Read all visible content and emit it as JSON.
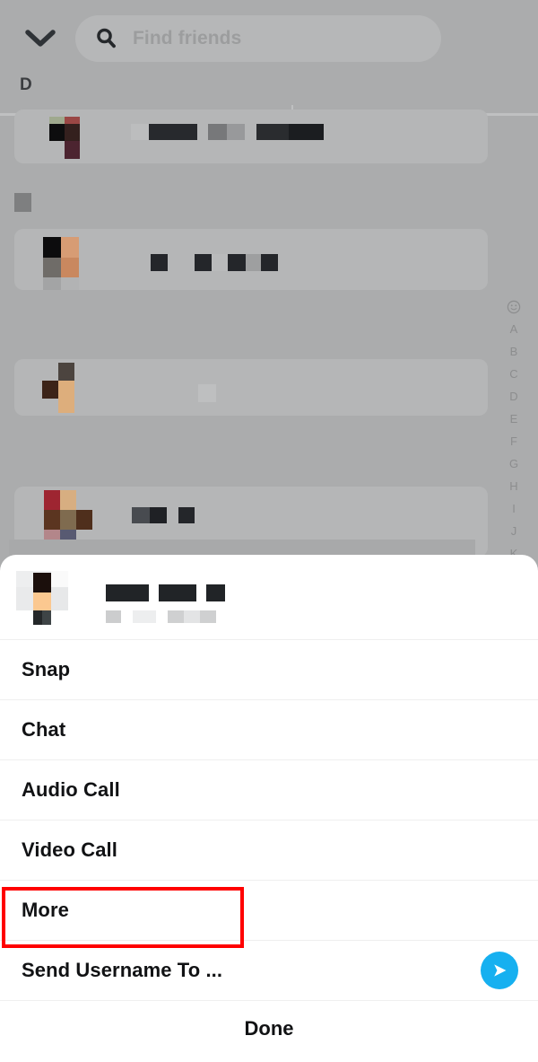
{
  "header": {
    "chevron_icon": "chevron-down-icon",
    "search": {
      "icon": "search-icon",
      "placeholder": "Find friends",
      "value": ""
    },
    "section_letter": "D"
  },
  "alpha_index": {
    "top_icon": "smiley-icon",
    "letters": [
      "A",
      "B",
      "C",
      "D",
      "E",
      "F",
      "G",
      "H",
      "I",
      "J",
      "K"
    ]
  },
  "friends_list": {
    "rows": [
      {
        "name": "[redacted]",
        "subtitle": "[redacted]"
      },
      {
        "name": "[redacted]",
        "subtitle": "[redacted]"
      },
      {
        "name": "[redacted]",
        "subtitle": "[redacted]"
      },
      {
        "name": "[redacted]",
        "subtitle": "[redacted]"
      }
    ]
  },
  "sheet": {
    "profile": {
      "avatar": "blurred-avatar",
      "display_name": "[redacted]",
      "username": "[redacted]"
    },
    "menu": [
      {
        "label": "Snap",
        "highlighted": false,
        "trailing_icon": ""
      },
      {
        "label": "Chat",
        "highlighted": false,
        "trailing_icon": ""
      },
      {
        "label": "Audio Call",
        "highlighted": false,
        "trailing_icon": ""
      },
      {
        "label": "Video Call",
        "highlighted": false,
        "trailing_icon": ""
      },
      {
        "label": "More",
        "highlighted": true,
        "trailing_icon": ""
      },
      {
        "label": "Send Username To ...",
        "highlighted": false,
        "trailing_icon": "send-icon"
      }
    ],
    "done_label": "Done"
  },
  "colors": {
    "backdrop": "#ABACAD",
    "row": "#B5B6B7",
    "sheet_bg": "#FFFFFF",
    "accent_send": "#16B0F0",
    "highlight": "#FF0000",
    "text": "#111214",
    "placeholder": "#9C9D9E"
  }
}
